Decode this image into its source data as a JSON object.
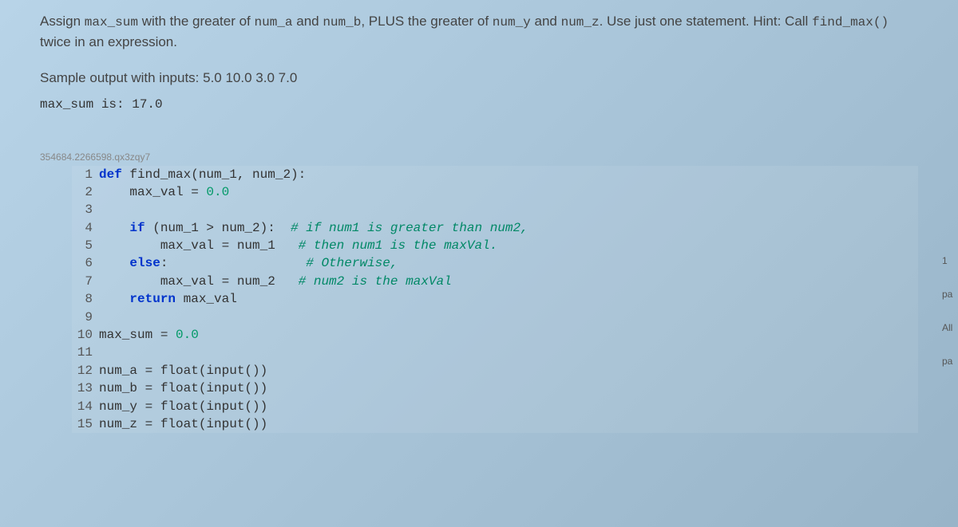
{
  "instruction": {
    "prefix": "Assign ",
    "c1": "max_sum",
    "t1": " with the greater of ",
    "c2": "num_a",
    "t2": " and ",
    "c3": "num_b",
    "t3": ", PLUS the greater of ",
    "c4": "num_y",
    "t4": " and ",
    "c5": "num_z",
    "t5": ". Use just one statement. Hint: Call ",
    "c6": "find_max()",
    "t6": " twice in an expression."
  },
  "sample_label": "Sample output with inputs: 5.0 10.0 3.0 7.0",
  "sample_output": "max_sum is: 17.0",
  "qid": "354684.2266598.qx3zqy7",
  "code": {
    "l1": {
      "kw1": "def",
      "rest": " find_max(num_1, num_2):"
    },
    "l2": {
      "indent": "    max_val = ",
      "num": "0.0"
    },
    "l3": "",
    "l4": {
      "indent": "    ",
      "kw": "if",
      "cond": " (num_1 > num_2):  ",
      "comment": "# if num1 is greater than num2,"
    },
    "l5": {
      "indent": "        max_val = num_1   ",
      "comment": "# then num1 is the maxVal."
    },
    "l6": {
      "indent": "    ",
      "kw": "else",
      "colon": ":                  ",
      "comment": "# Otherwise,"
    },
    "l7": {
      "indent": "        max_val = num_2   ",
      "comment": "# num2 is the maxVal"
    },
    "l8": {
      "indent": "    ",
      "kw": "return",
      "rest": " max_val"
    },
    "l9": "",
    "l10": {
      "text": "max_sum = ",
      "num": "0.0"
    },
    "l11": "",
    "l12": "num_a = float(input())",
    "l13": "num_b = float(input())",
    "l14": "num_y = float(input())",
    "l15": "num_z = float(input())"
  },
  "nums": {
    "n1": "1",
    "n2": "2",
    "n3": "3",
    "n4": "4",
    "n5": "5",
    "n6": "6",
    "n7": "7",
    "n8": "8",
    "n9": "9",
    "n10": "10",
    "n11": "11",
    "n12": "12",
    "n13": "13",
    "n14": "14",
    "n15": "15"
  },
  "side": {
    "s1": "1",
    "s2": "pa",
    "s3": "All",
    "s4": "pa"
  }
}
